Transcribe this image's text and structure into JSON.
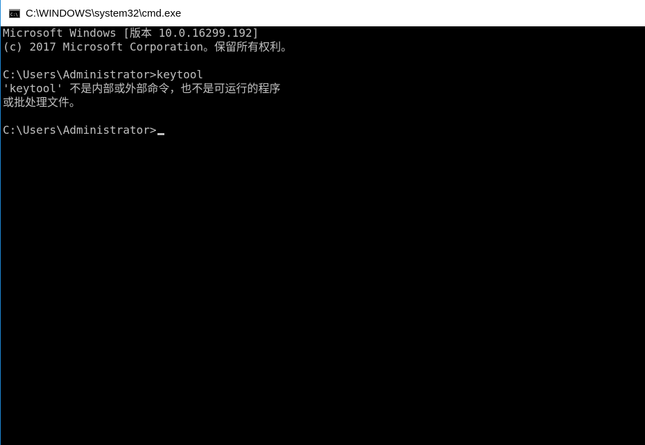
{
  "window": {
    "title": "C:\\WINDOWS\\system32\\cmd.exe",
    "icon": "cmd-console-icon"
  },
  "console": {
    "text_color": "#c0c0c0",
    "background_color": "#000000",
    "lines": [
      "Microsoft Windows [版本 10.0.16299.192]",
      "(c) 2017 Microsoft Corporation。保留所有权利。",
      "",
      "C:\\Users\\Administrator>keytool",
      "'keytool' 不是内部或外部命令，也不是可运行的程序",
      "或批处理文件。",
      "",
      "C:\\Users\\Administrator>"
    ]
  }
}
